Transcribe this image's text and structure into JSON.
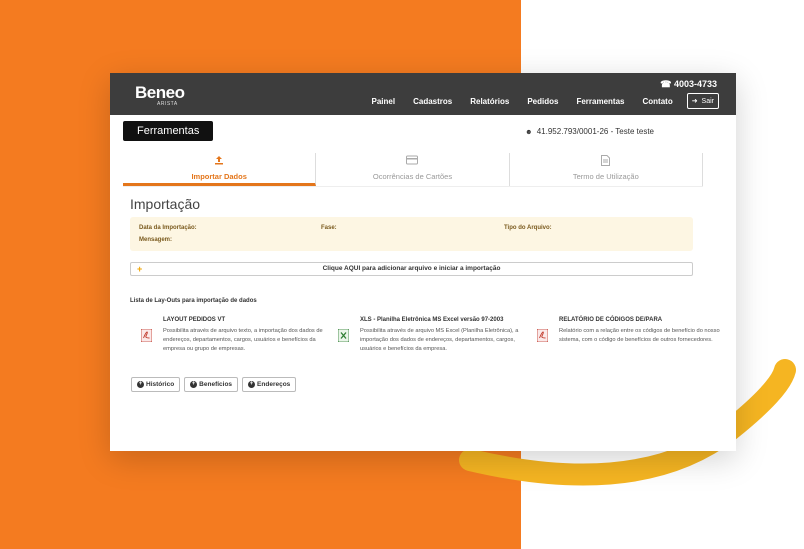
{
  "header": {
    "logo": "Beneo",
    "logo_sub": "ARISTA",
    "phone": "4003-4733",
    "nav": [
      "Painel",
      "Cadastros",
      "Relatórios",
      "Pedidos",
      "Ferramentas",
      "Contato"
    ],
    "logout_label": "Sair"
  },
  "page": {
    "title": "Ferramentas",
    "user_info": "41.952.793/0001-26 - Teste teste"
  },
  "tabs": [
    {
      "label": "Importar Dados",
      "icon": "upload-icon",
      "active": true
    },
    {
      "label": "Ocorrências de Cartões",
      "icon": "credit-card-icon",
      "active": false
    },
    {
      "label": "Termo de Utilização",
      "icon": "document-icon",
      "active": false
    }
  ],
  "import": {
    "section_title": "Importação",
    "date_label": "Data da Importação:",
    "phase_label": "Fase:",
    "file_type_label": "Tipo do Arquivo:",
    "message_label": "Mensagem:",
    "upload_text": "Clique AQUI para adicionar arquivo e iniciar a importação"
  },
  "layouts": {
    "title": "Lista de Lay-Outs para importação de dados",
    "items": [
      {
        "name": "LAYOUT PEDIDOS VT",
        "icon": "pdf-icon",
        "description": "Possibilita através de arquivo texto, a importação dos dados de endereços, departamentos, cargos, usuários e benefícios da empresa ou grupo de empresas."
      },
      {
        "name": "XLS - Planilha Eletrônica MS Excel versão 97-2003",
        "icon": "excel-icon",
        "description": "Possibilita através de arquivo MS Excel (Planilha Eletrônica), a importação dos dados de endereços, departamentos, cargos, usuários e benefícios da empresa."
      },
      {
        "name": "RELATÓRIO DE CÓDIGOS DE/PARA",
        "icon": "pdf-icon",
        "description": "Relatório com a relação entre os códigos de benefício do nosso sistema, com o código de benefícios de outros fornecedores."
      }
    ]
  },
  "history_buttons": [
    "Histórico",
    "Benefícios",
    "Endereços"
  ],
  "colors": {
    "accent": "#e4761b",
    "background_orange": "#f47b20",
    "arc_yellow": "#f5b522",
    "topbar": "#3d3d3d"
  }
}
